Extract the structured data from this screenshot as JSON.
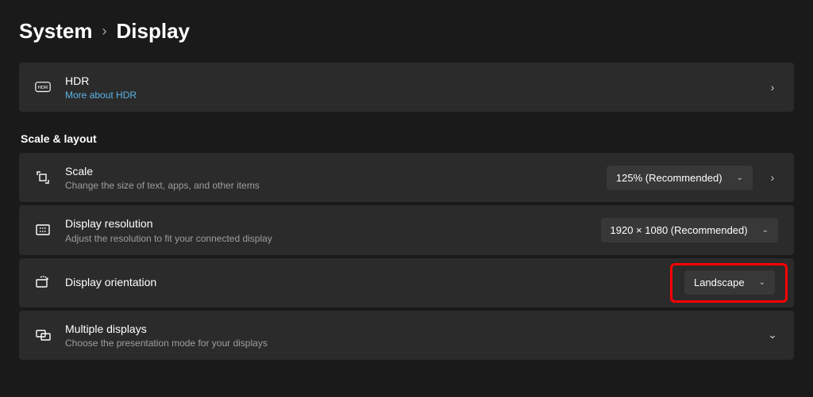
{
  "breadcrumb": {
    "parent": "System",
    "separator": "›",
    "current": "Display"
  },
  "hdr": {
    "title": "HDR",
    "link": "More about HDR"
  },
  "sectionHeading": "Scale & layout",
  "scale": {
    "title": "Scale",
    "sub": "Change the size of text, apps, and other items",
    "value": "125% (Recommended)"
  },
  "resolution": {
    "title": "Display resolution",
    "sub": "Adjust the resolution to fit your connected display",
    "value": "1920 × 1080 (Recommended)"
  },
  "orientation": {
    "title": "Display orientation",
    "value": "Landscape"
  },
  "multiple": {
    "title": "Multiple displays",
    "sub": "Choose the presentation mode for your displays"
  }
}
